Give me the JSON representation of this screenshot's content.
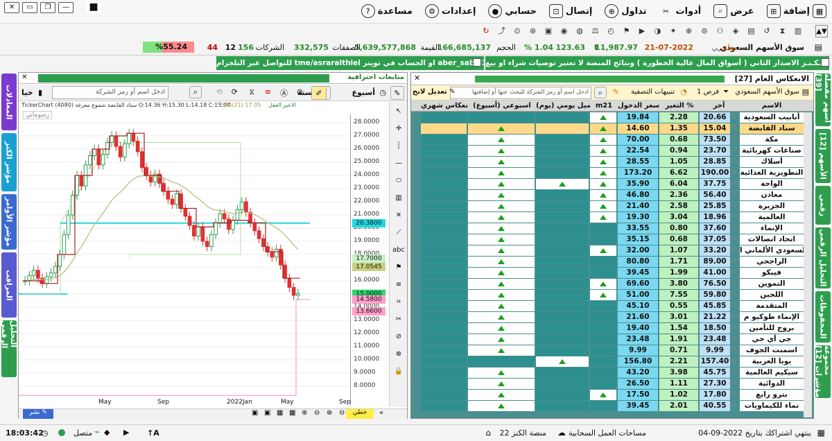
{
  "window": {
    "controls": [
      "—",
      "❐",
      "□",
      "▭",
      "✕"
    ]
  },
  "menu": [
    {
      "label": "إضافة",
      "icon": "add-icon"
    },
    {
      "label": "عرض",
      "icon": "view-icon"
    },
    {
      "label": "أدوات",
      "icon": "tools-icon"
    },
    {
      "label": "تداول",
      "icon": "trade-icon"
    },
    {
      "label": "إتصال",
      "icon": "connect-icon"
    },
    {
      "label": "حسابي",
      "icon": "account-icon"
    },
    {
      "label": "إعدادات",
      "icon": "settings-icon"
    },
    {
      "label": "مساعدة",
      "icon": "help-icon"
    }
  ],
  "ticker": {
    "market": "سوق الأسهم السعودي",
    "status": "مغلق",
    "date": "21-07-2022",
    "index": "11,987.97",
    "change": "123.63",
    "change_pct": "% 1.04",
    "volume_label": "الحجم",
    "volume": "166,685,137",
    "value_label": "القيمة",
    "value": "5,639,577,868",
    "deals_label": "الصفقات",
    "deals": "332,575",
    "companies_label": "الشركات",
    "companies": "156",
    "unchanged": "12",
    "down": "44",
    "up_pct": "%55.24"
  },
  "notice": {
    "text": "منـصـة الـكـنـز الاصدار الثاني ( أسواق المال عالية الخطورة ) ونتائج المنصة لا تعتبر توصيات شراء او بيع",
    "contact": "للتواصل عبر التلجرام  tme/asraralthiel   او الحساب في تويتر  aber_sabel3@"
  },
  "right_tabs": [
    "أسهم مفضلة [39]",
    "الأسهم [12]",
    "رقمي",
    "التحليل الرقمي",
    "المحفوظات",
    "مجموعة مؤشرات [12]"
  ],
  "left_tabs": [
    "المعادلات",
    "مؤشر الكنز",
    "مؤشر الأوامر",
    "المراقب",
    "التحليل الرقمي"
  ],
  "chart": {
    "title": "متابعات احترافية",
    "period_label": "أسبوع",
    "range_label": "سنة",
    "search_placeholder": "ادخل اسم أو رمز الشركة",
    "caption": "TickerChart   (4080) سناد القابضة شموع مفرغة  O:14.36 H:15.30 L:14.18 C:15.04",
    "ema_label": "EMA(21)  17.05",
    "legend_right": "الاخير العقل",
    "watermark": "رسوماتي",
    "y_ticks": [
      "28.0000",
      "27.0000",
      "26.0000",
      "25.0000",
      "24.0000",
      "23.0000",
      "22.0000",
      "21.0000",
      "20.0000",
      "19.0000",
      "18.0000",
      "17.0000",
      "16.0000",
      "15.0000",
      "14.0000",
      "13.0000",
      "12.0000",
      "11.0000",
      "10.0000",
      "9.0000",
      "8.0000"
    ],
    "price_tags": [
      {
        "v": "20.3800",
        "c": "#22d6e0"
      },
      {
        "v": "17.7000",
        "c": "#c8f0c8"
      },
      {
        "v": "17.0545",
        "c": "#c8d080"
      },
      {
        "v": "15.0400",
        "c": "#c8f0c8"
      },
      {
        "v": "15.0000",
        "c": "#2ed66e"
      },
      {
        "v": "14.5800",
        "c": "#ff9ec8"
      },
      {
        "v": "13.6600",
        "c": "#ff9ec8"
      }
    ],
    "x_ticks": [
      "May",
      "Sep",
      "2022Jan",
      "May",
      "Sep"
    ],
    "publish": "نشر",
    "draw_label": "خطي"
  },
  "table": {
    "title": "الانعكاس العام [27]",
    "market_filter": "سوق الأسهم السعودي",
    "opportunities": "فرص 1",
    "alerts": "تنبيهات التصفية",
    "search_placeholder": "ادخل اسم أو رمز الشركة للبحث عنها أو إضافتها",
    "edit": "تعديل لانح",
    "headers": [
      "الاسم",
      "آخر",
      "التغير %",
      "سعر الدخول",
      "m21",
      "الجميل يومي (يوم)",
      "اسبوعي (أسبوع)",
      "انعكاس شهري"
    ],
    "rows": [
      {
        "name": "أنابيب السعودية",
        "last": "20.66",
        "chg": "2.28",
        "entry": "19.84",
        "m21": true,
        "d": false,
        "w": false,
        "m": false
      },
      {
        "name": "سناد القابضة",
        "last": "15.04",
        "chg": "1.35",
        "entry": "14.60",
        "m21": true,
        "d": false,
        "w": true,
        "m": false,
        "sel": true
      },
      {
        "name": "مكة",
        "last": "73.50",
        "chg": "0.68",
        "entry": "70.00",
        "m21": true,
        "d": false,
        "w": true,
        "m": false
      },
      {
        "name": "صناعات كهربائية",
        "last": "23.70",
        "chg": "0.94",
        "entry": "22.54",
        "m21": true,
        "d": false,
        "w": true,
        "m": false
      },
      {
        "name": "أسلاك",
        "last": "28.85",
        "chg": "1.05",
        "entry": "28.55",
        "m21": true,
        "d": false,
        "w": true,
        "m": false
      },
      {
        "name": "التطويرية الغذائية",
        "last": "190.00",
        "chg": "6.62",
        "entry": "173.20",
        "m21": true,
        "d": false,
        "w": true,
        "m": false
      },
      {
        "name": "الواحة",
        "last": "37.75",
        "chg": "6.04",
        "entry": "35.90",
        "m21": true,
        "d": true,
        "w": true,
        "m": false
      },
      {
        "name": "معادن",
        "last": "56.40",
        "chg": "2.36",
        "entry": "46.80",
        "m21": true,
        "d": false,
        "w": true,
        "m": false
      },
      {
        "name": "الجزيرة",
        "last": "25.85",
        "chg": "2.58",
        "entry": "21.40",
        "m21": true,
        "d": false,
        "w": true,
        "m": false
      },
      {
        "name": "العالمية",
        "last": "18.96",
        "chg": "3.04",
        "entry": "19.30",
        "m21": true,
        "d": false,
        "w": true,
        "m": false
      },
      {
        "name": "الإنماء",
        "last": "37.60",
        "chg": "0.80",
        "entry": "33.55",
        "m21": false,
        "d": false,
        "w": true,
        "m": false
      },
      {
        "name": "اتحاد اتصالات",
        "last": "37.05",
        "chg": "0.68",
        "entry": "35.15",
        "m21": false,
        "d": false,
        "w": true,
        "m": false
      },
      {
        "name": "السعودي الألماني ا",
        "last": "33.20",
        "chg": "1.07",
        "entry": "32.00",
        "m21": true,
        "d": false,
        "w": true,
        "m": false
      },
      {
        "name": "الراجحي",
        "last": "89.00",
        "chg": "1.71",
        "entry": "80.80",
        "m21": false,
        "d": false,
        "w": true,
        "m": false
      },
      {
        "name": "فيبكو",
        "last": "41.00",
        "chg": "1.99",
        "entry": "39.45",
        "m21": false,
        "d": false,
        "w": true,
        "m": false
      },
      {
        "name": "التموين",
        "last": "76.50",
        "chg": "3.80",
        "entry": "69.60",
        "m21": true,
        "d": false,
        "w": true,
        "m": false
      },
      {
        "name": "اللجين",
        "last": "59.80",
        "chg": "7.55",
        "entry": "51.00",
        "m21": true,
        "d": false,
        "w": true,
        "m": false
      },
      {
        "name": "المتقدمة",
        "last": "45.85",
        "chg": "0.55",
        "entry": "45.10",
        "m21": false,
        "d": false,
        "w": true,
        "m": false
      },
      {
        "name": "الإنماء طوكيو م",
        "last": "21.22",
        "chg": "3.01",
        "entry": "21.60",
        "m21": false,
        "d": false,
        "w": true,
        "m": false
      },
      {
        "name": "بروج للتأمين",
        "last": "18.50",
        "chg": "1.54",
        "entry": "19.40",
        "m21": false,
        "d": false,
        "w": true,
        "m": false
      },
      {
        "name": "جي أي جي",
        "last": "23.48",
        "chg": "1.91",
        "entry": "23.48",
        "m21": false,
        "d": false,
        "w": true,
        "m": false
      },
      {
        "name": "اسمنت الجوف",
        "last": "9.99",
        "chg": "0.71",
        "entry": "9.99",
        "m21": false,
        "d": false,
        "w": true,
        "m": false
      },
      {
        "name": "بوبا العربية",
        "last": "157.40",
        "chg": "2.21",
        "entry": "156.80",
        "m21": false,
        "d": true,
        "w": false,
        "m": false
      },
      {
        "name": "سيكيم العالمية",
        "last": "45.75",
        "chg": "3.98",
        "entry": "43.20",
        "m21": false,
        "d": false,
        "w": true,
        "m": false
      },
      {
        "name": "الدوائية",
        "last": "27.30",
        "chg": "1.11",
        "entry": "26.50",
        "m21": false,
        "d": false,
        "w": true,
        "m": false
      },
      {
        "name": "بترو رابغ",
        "last": "17.80",
        "chg": "1.02",
        "entry": "17.50",
        "m21": true,
        "d": false,
        "w": true,
        "m": false
      },
      {
        "name": "نماء للكيماويات",
        "last": "40.55",
        "chg": "2.01",
        "entry": "39.45",
        "m21": false,
        "d": false,
        "w": true,
        "m": false
      }
    ]
  },
  "status": {
    "subscription": "ينتهي اشتراكك بتاريخ 2022-09-04",
    "workspace": "مساحات العمل السحابية",
    "platform": "منصة الكنز 22",
    "connected": "متصل",
    "time": "18:03:42"
  },
  "colors": {
    "green": "#2e9e4e",
    "teal": "#4a8f8f",
    "cyan": "#22d6e0",
    "highlight": "#ffe08a"
  }
}
